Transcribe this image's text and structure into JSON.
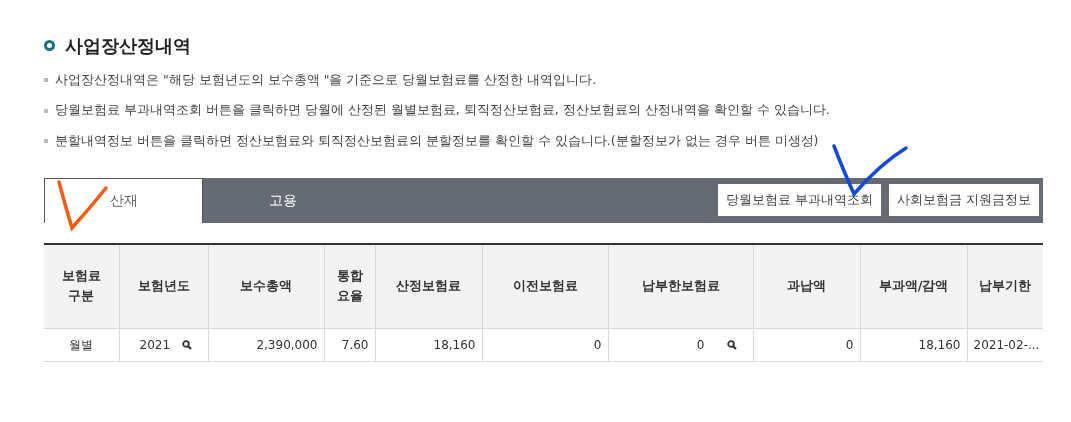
{
  "section": {
    "title": "사업장산정내역",
    "notes": [
      "사업장산정내역은 \"해당 보험년도의 보수총액 \"을 기준으로 당월보험료를 산정한 내역입니다.",
      "당월보험료 부과내역조회 버튼을 클릭하면 당월에 산정된 월별보험료, 퇴직정산보험료, 정산보험료의 산정내역을 확인할 수 있습니다.",
      "분할내역정보 버튼을 클릭하면 정산보험료와 퇴직정산보험료의  분할정보를 확인할 수 있습니다.(분할정보가 없는 경우 버튼 미생성)"
    ]
  },
  "tabs": [
    {
      "label": "산재",
      "selected": true
    },
    {
      "label": "고용",
      "selected": false
    }
  ],
  "buttons": [
    "당월보험료 부과내역조회",
    "사회보험금 지원금정보"
  ],
  "table": {
    "columns": [
      "보험료\n구분",
      "보험년도",
      "보수총액",
      "통합\n요율",
      "산정보험료",
      "이전보험료",
      "납부한보험료",
      "과납액",
      "부과액/감액",
      "납부기한"
    ],
    "rows": [
      [
        {
          "text": "월별",
          "has_search": false
        },
        {
          "text": "2021",
          "has_search": true
        },
        {
          "text": "2,390,000",
          "has_search": false
        },
        {
          "text": "7.60",
          "has_search": false
        },
        {
          "text": "18,160",
          "has_search": false
        },
        {
          "text": "0",
          "has_search": false
        },
        {
          "text": "0",
          "has_search": true
        },
        {
          "text": "0",
          "has_search": false
        },
        {
          "text": "18,160",
          "has_search": false
        },
        {
          "text": "2021-02-...",
          "has_search": false
        }
      ]
    ]
  },
  "annotations": [
    {
      "kind": "check",
      "color": "#f25c12"
    },
    {
      "kind": "check",
      "color": "#1448d6"
    }
  ]
}
